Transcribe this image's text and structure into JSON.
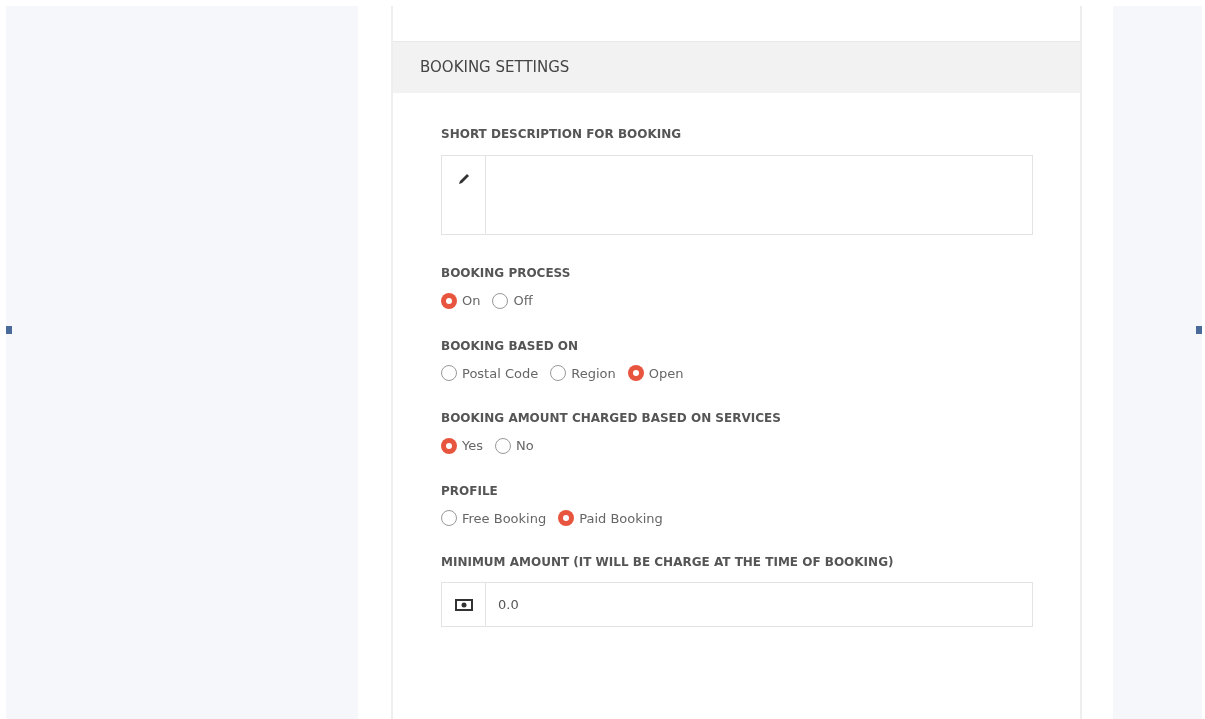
{
  "section": {
    "title": "BOOKING SETTINGS"
  },
  "description": {
    "label": "SHORT DESCRIPTION FOR BOOKING"
  },
  "radio_groups": [
    {
      "label": "BOOKING PROCESS",
      "options": [
        {
          "label": "On",
          "selected": true
        },
        {
          "label": "Off",
          "selected": false
        }
      ]
    },
    {
      "label": "BOOKING BASED ON",
      "options": [
        {
          "label": "Postal Code",
          "selected": false
        },
        {
          "label": "Region",
          "selected": false
        },
        {
          "label": "Open",
          "selected": true
        }
      ]
    },
    {
      "label": "BOOKING AMOUNT CHARGED BASED ON SERVICES",
      "options": [
        {
          "label": "Yes",
          "selected": true
        },
        {
          "label": "No",
          "selected": false
        }
      ]
    },
    {
      "label": "PROFILE",
      "options": [
        {
          "label": "Free Booking",
          "selected": false
        },
        {
          "label": "Paid Booking",
          "selected": true
        }
      ]
    }
  ],
  "minimum_amount": {
    "label": "MINIMUM AMOUNT (IT WILL BE CHARGE AT THE TIME OF BOOKING)",
    "value": "0.0"
  }
}
